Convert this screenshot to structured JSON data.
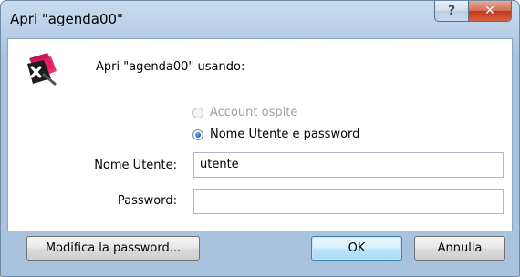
{
  "window": {
    "title": "Apri \"agenda00\"",
    "help_glyph": "?",
    "close_glyph": "✕"
  },
  "dialog": {
    "app_icon": "filemaker-app-icon",
    "prompt": "Apri \"agenda00\" usando:",
    "login_options": [
      {
        "label": "Account ospite",
        "selected": false,
        "enabled": false
      },
      {
        "label": "Nome Utente e password",
        "selected": true,
        "enabled": true
      }
    ],
    "username": {
      "label": "Nome Utente:",
      "value": "utente"
    },
    "password": {
      "label": "Password:",
      "value": ""
    }
  },
  "buttons": {
    "change_password": "Modifica la password...",
    "ok": "OK",
    "cancel": "Annulla"
  },
  "colors": {
    "frame": "#b7cde6",
    "default_button": "#bee6fd",
    "close_button": "#c0391f"
  }
}
